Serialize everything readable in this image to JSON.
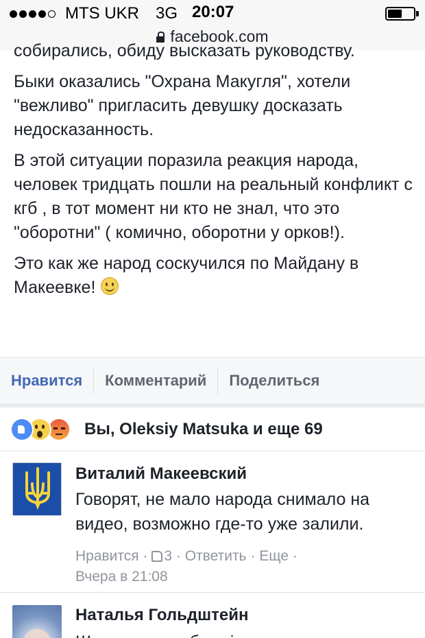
{
  "status_bar": {
    "carrier": "MTS UKR",
    "network": "3G",
    "time": "20:07",
    "battery_percent": 55
  },
  "url_bar": {
    "domain": "facebook.com"
  },
  "post": {
    "cut_line": "собирались, обиду высказать руководству.",
    "paragraphs": [
      "Быки оказались \"Охрана Макугля\", хотели \"вежливо\" пригласить девушку досказать недосказанность.",
      "В этой ситуации поразила реакция народа, человек тридцать пошли на реальный конфликт с кгб , в тот момент ни кто не знал, что это \"оборотни\" ( комично, оборотни у орков!).",
      "Это как же народ соскучился по Майдану в Макеевке!"
    ]
  },
  "actions": {
    "like": "Нравится",
    "comment": "Комментарий",
    "share": "Поделиться"
  },
  "reactions": {
    "icons": [
      "like-icon",
      "wow-icon",
      "angry-icon"
    ],
    "summary": "Вы, Oleksiy Matsuka и еще 69"
  },
  "comments": [
    {
      "author": "Виталий Макеевский",
      "text": "Говорят, не мало народа снимало на видео, возможно где-то уже залили.",
      "like_label": "Нравится",
      "like_count": "3",
      "reply_label": "Ответить",
      "more_label": "Еще",
      "time": "Вчера в 21:08"
    },
    {
      "author": "Наталья Гольдштейн",
      "text": "Шкода народ, без підтримки силуть"
    }
  ],
  "colors": {
    "link_blue": "#4267b2",
    "meta_gray": "#90949c",
    "text": "#1d2129"
  }
}
